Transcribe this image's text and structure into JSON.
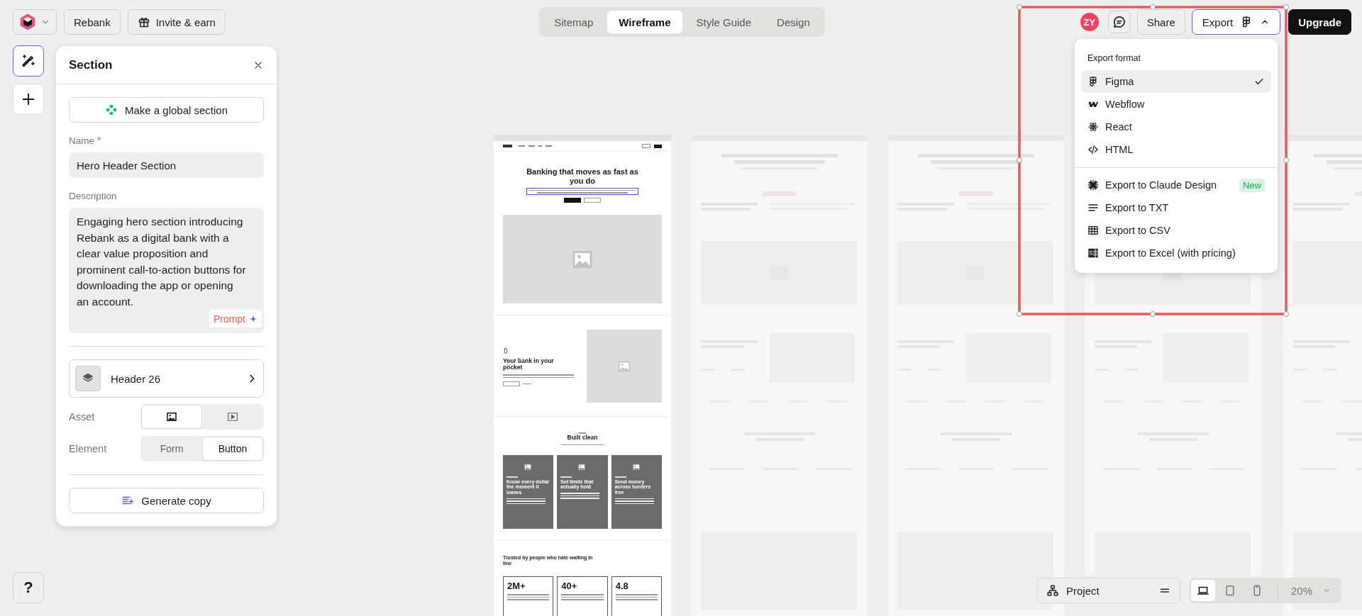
{
  "top_bar": {
    "project_name": "Rebank",
    "invite": "Invite & earn"
  },
  "view_tabs": [
    {
      "label": "Sitemap",
      "selected": false
    },
    {
      "label": "Wireframe",
      "selected": true
    },
    {
      "label": "Style Guide",
      "selected": false
    },
    {
      "label": "Design",
      "selected": false
    }
  ],
  "header_actions": {
    "avatar": "ZY",
    "share": "Share",
    "export": {
      "label": "Export",
      "expanded": true
    },
    "upgrade": "Upgrade"
  },
  "export_menu": {
    "title": "Export format",
    "formats": [
      {
        "label": "Figma",
        "kind": "figma",
        "selected": true
      },
      {
        "label": "Webflow",
        "kind": "webflow",
        "selected": false
      },
      {
        "label": "React",
        "kind": "react",
        "selected": false
      },
      {
        "label": "HTML",
        "kind": "code",
        "selected": false
      }
    ],
    "actions": [
      {
        "label": "Export to Claude Design",
        "kind": "burst",
        "badge": "New"
      },
      {
        "label": "Export to TXT",
        "kind": "lines"
      },
      {
        "label": "Export to CSV",
        "kind": "table"
      },
      {
        "label": "Export to Excel (with pricing)",
        "kind": "sheet"
      }
    ]
  },
  "tools": [
    {
      "kind": "magic",
      "selected": true
    },
    {
      "kind": "add",
      "selected": false
    }
  ],
  "help": "?",
  "section_panel": {
    "title": "Section",
    "global_button": "Make a global section",
    "name_label": "Name",
    "required_mark": "*",
    "name_value": "Hero Header Section",
    "description_label": "Description",
    "description_value": "Engaging hero section introducing Rebank as a digital bank with a clear value proposition and prominent call-to-action buttons for downloading the app or opening an account.",
    "prompt_button": "Prompt",
    "component": "Header 26",
    "asset_label": "Asset",
    "asset_options": [
      {
        "kind": "image",
        "selected": true
      },
      {
        "kind": "video",
        "selected": false
      }
    ],
    "element_label": "Element",
    "element_options": [
      {
        "label": "Form",
        "selected": false
      },
      {
        "label": "Button",
        "selected": true
      }
    ],
    "generate_button": "Generate copy"
  },
  "home_page": {
    "hero": {
      "heading": "Banking that moves as fast as you do",
      "description_selected": true
    },
    "pocket": {
      "heading": "Your bank in your pocket"
    },
    "features": {
      "heading": "Built clean",
      "cards": [
        {
          "heading": "Know every dollar the moment it leaves"
        },
        {
          "heading": "Set limits that actually hold"
        },
        {
          "heading": "Send money across borders free"
        }
      ]
    },
    "stats": {
      "heading": "Trusted by people who hate waiting in line",
      "items": [
        {
          "value": "2M+"
        },
        {
          "value": "40+"
        },
        {
          "value": "4.8"
        }
      ]
    }
  },
  "canvas": {
    "selection_shown": true
  },
  "bottom_bar": {
    "project": "Project",
    "devices": [
      {
        "kind": "desktop",
        "selected": true
      },
      {
        "kind": "tablet",
        "selected": false
      },
      {
        "kind": "mobile",
        "selected": false
      }
    ],
    "zoom": "20%"
  }
}
